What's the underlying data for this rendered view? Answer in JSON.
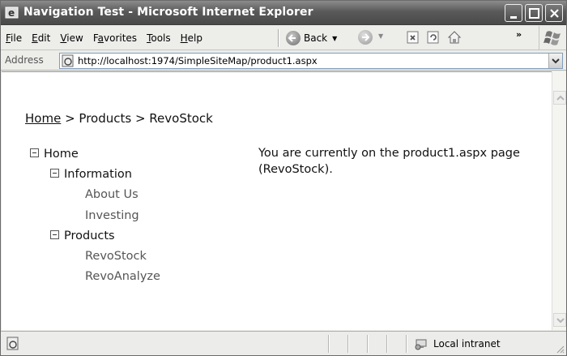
{
  "window": {
    "title": "Navigation Test - Microsoft Internet Explorer"
  },
  "menu": {
    "items": [
      {
        "label": "File",
        "accel": "F",
        "rest": "ile"
      },
      {
        "label": "Edit",
        "accel": "E",
        "rest": "dit"
      },
      {
        "label": "View",
        "accel": "V",
        "rest": "iew"
      },
      {
        "label": "Favorites",
        "accel": "a",
        "pre": "F",
        "rest": "vorites"
      },
      {
        "label": "Tools",
        "accel": "T",
        "rest": "ools"
      },
      {
        "label": "Help",
        "accel": "H",
        "rest": "elp"
      }
    ]
  },
  "toolbar": {
    "back_label": "Back",
    "overflow": "»"
  },
  "address": {
    "label": "Address",
    "url": "http://localhost:1974/SimpleSiteMap/product1.aspx"
  },
  "page": {
    "breadcrumb": {
      "home": "Home",
      "sep1": " > ",
      "products": "Products",
      "sep2": " > ",
      "current": "RevoStock"
    },
    "tree": {
      "home": "Home",
      "information": "Information",
      "about": "About Us",
      "investing": "Investing",
      "products": "Products",
      "revostock": "RevoStock",
      "revoanalyze": "RevoAnalyze"
    },
    "message": "You are currently on the product1.aspx page (RevoStock)."
  },
  "status": {
    "zone": "Local intranet"
  }
}
